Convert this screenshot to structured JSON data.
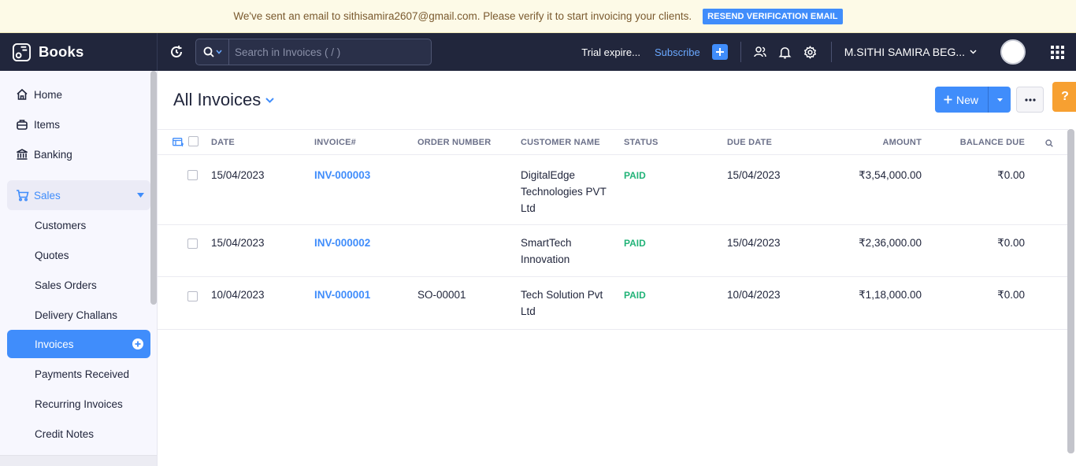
{
  "banner": {
    "message": "We've sent an email to sithisamira2607@gmail.com. Please verify it to start invoicing your clients.",
    "button_label": "RESEND VERIFICATION EMAIL"
  },
  "topbar": {
    "app_name": "Books",
    "search_placeholder": "Search in Invoices ( / )",
    "trial_text": "Trial expire...",
    "subscribe_label": "Subscribe",
    "org_name": "M.SITHI SAMIRA BEG..."
  },
  "sidebar": {
    "items": [
      {
        "label": "Home",
        "icon": "home-icon"
      },
      {
        "label": "Items",
        "icon": "items-icon"
      },
      {
        "label": "Banking",
        "icon": "bank-icon"
      }
    ],
    "sales": {
      "label": "Sales",
      "icon": "cart-icon"
    },
    "sub_items": [
      {
        "label": "Customers"
      },
      {
        "label": "Quotes"
      },
      {
        "label": "Sales Orders"
      },
      {
        "label": "Delivery Challans"
      },
      {
        "label": "Invoices",
        "active": true
      },
      {
        "label": "Payments Received"
      },
      {
        "label": "Recurring Invoices"
      },
      {
        "label": "Credit Notes"
      }
    ]
  },
  "main": {
    "title": "All Invoices",
    "new_label": "New",
    "help_label": "?",
    "columns": [
      "DATE",
      "INVOICE#",
      "ORDER NUMBER",
      "CUSTOMER NAME",
      "STATUS",
      "DUE DATE",
      "AMOUNT",
      "BALANCE DUE"
    ],
    "rows": [
      {
        "date": "15/04/2023",
        "invoice": "INV-000003",
        "order": "",
        "customer": "DigitalEdge Technologies PVT Ltd",
        "status": "PAID",
        "due_date": "15/04/2023",
        "amount": "₹3,54,000.00",
        "balance": "₹0.00"
      },
      {
        "date": "15/04/2023",
        "invoice": "INV-000002",
        "order": "",
        "customer": "SmartTech Innovation",
        "status": "PAID",
        "due_date": "15/04/2023",
        "amount": "₹2,36,000.00",
        "balance": "₹0.00"
      },
      {
        "date": "10/04/2023",
        "invoice": "INV-000001",
        "order": "SO-00001",
        "customer": "Tech Solution Pvt Ltd",
        "status": "PAID",
        "due_date": "10/04/2023",
        "amount": "₹1,18,000.00",
        "balance": "₹0.00"
      }
    ]
  },
  "colors": {
    "accent": "#408dfb",
    "topbar": "#21263c",
    "paid": "#22b378",
    "help": "#f7a031"
  }
}
